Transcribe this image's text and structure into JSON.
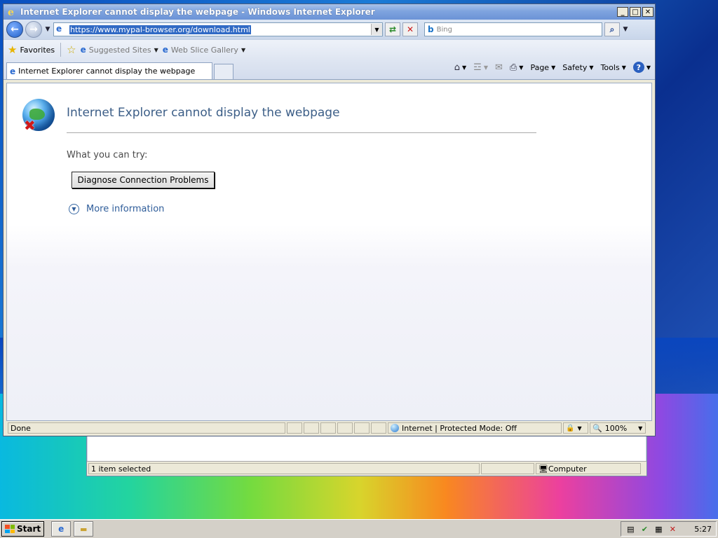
{
  "window": {
    "title": "Internet Explorer cannot display the webpage - Windows Internet Explorer"
  },
  "address": {
    "url": "https://www.mypal-browser.org/download.html"
  },
  "search": {
    "placeholder": "Bing"
  },
  "favorites": {
    "favorites_label": "Favorites",
    "suggested_sites": "Suggested Sites",
    "web_slice_gallery": "Web Slice Gallery"
  },
  "tab": {
    "title": "Internet Explorer cannot display the webpage"
  },
  "commands": {
    "page": "Page",
    "safety": "Safety",
    "tools": "Tools"
  },
  "content": {
    "heading": "Internet Explorer cannot display the webpage",
    "try_label": "What you can try:",
    "diagnose_button": "Diagnose Connection Problems",
    "more_info": "More information"
  },
  "status": {
    "state": "Done",
    "zone": "Internet | Protected Mode: Off",
    "zoom": "100%"
  },
  "explorer_status": {
    "selection": "1 item selected",
    "location": "Computer"
  },
  "taskbar": {
    "start": "Start",
    "clock": "5:27"
  },
  "colors": {
    "heading_blue": "#3c5e87",
    "link_blue": "#2f5d9a",
    "url_highlight": "#316ac5"
  }
}
